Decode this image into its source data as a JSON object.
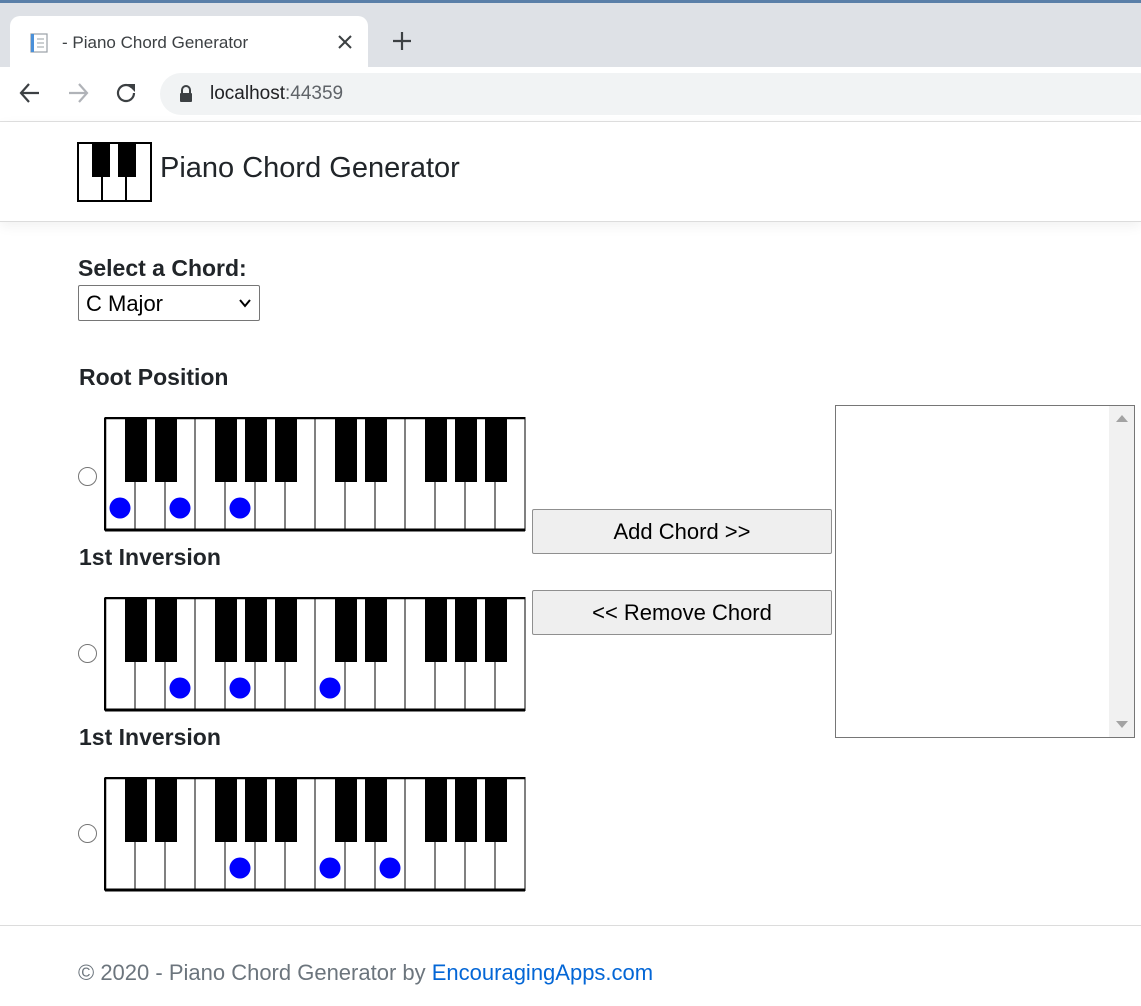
{
  "browser": {
    "tab_title": "- Piano Chord Generator",
    "url_host": "localhost",
    "url_port": ":44359"
  },
  "header": {
    "brand": "Piano Chord Generator"
  },
  "main": {
    "select_label": "Select a Chord:",
    "selected_chord": "C Major",
    "add_button": "Add Chord >>",
    "remove_button": "<< Remove Chord",
    "positions": [
      {
        "label": "Root Position",
        "highlighted_white_keys": [
          0,
          2,
          4
        ]
      },
      {
        "label": "1st Inversion",
        "highlighted_white_keys": [
          2,
          4,
          7
        ]
      },
      {
        "label": "1st Inversion",
        "highlighted_white_keys": [
          4,
          7,
          9
        ]
      }
    ],
    "keyboard": {
      "white_key_count": 14,
      "black_key_after_white": [
        0,
        1,
        3,
        4,
        5,
        7,
        8,
        10,
        11,
        12
      ],
      "dot_color": "#0000ff"
    }
  },
  "footer": {
    "text": "© 2020 - Piano Chord Generator by ",
    "link": "EncouragingApps.com"
  }
}
